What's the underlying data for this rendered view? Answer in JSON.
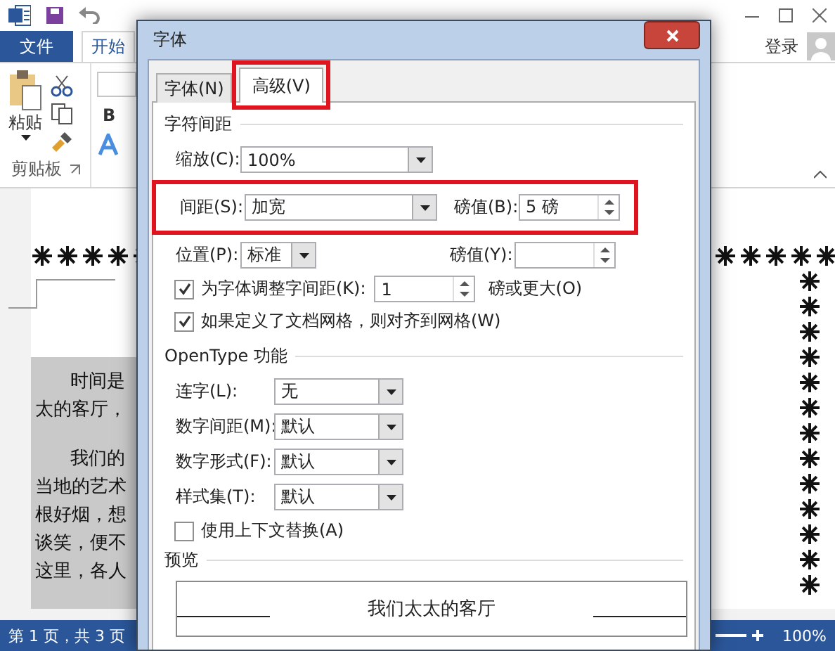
{
  "word": {
    "tabs": [
      {
        "label": "文件",
        "kind": "file",
        "selected": false
      },
      {
        "label": "开始",
        "kind": "tab",
        "selected": true
      }
    ],
    "account": "登录",
    "clipboard": {
      "paste": "粘贴",
      "group": "剪贴板"
    },
    "font_group": {
      "bold": "B"
    },
    "document": {
      "paragraphs": [
        [
          "时间是",
          "太的客厅，"
        ],
        [
          "我们的",
          "当地的艺术",
          "根好烟，想",
          "谈笑，便不",
          "这里，各人"
        ]
      ]
    },
    "status_bar": {
      "page": "第 1 页，共 3 页",
      "zoom": "100%"
    }
  },
  "dialog": {
    "title": "字体",
    "tabs": [
      {
        "label": "字体(N)",
        "selected": false
      },
      {
        "label": "高级(V)",
        "selected": true
      }
    ],
    "spacing_section": {
      "title": "字符间距",
      "scale": {
        "label": "缩放(C):",
        "value": "100%"
      },
      "spacing": {
        "label": "间距(S):",
        "value": "加宽",
        "by_label": "磅值(B):",
        "by_value": "5 磅"
      },
      "position": {
        "label": "位置(P):",
        "value": "标准",
        "by_label": "磅值(Y):"
      },
      "kerning": {
        "label": "为字体调整字间距(K):",
        "checked": true,
        "value": "1",
        "suffix": "磅或更大(O)"
      },
      "snap_to_grid": {
        "label": "如果定义了文档网格，则对齐到网格(W)",
        "checked": true
      }
    },
    "opentype": {
      "title": "OpenType 功能",
      "rows": [
        {
          "label": "连字(L):",
          "value": "无"
        },
        {
          "label": "数字间距(M):",
          "value": "默认"
        },
        {
          "label": "数字形式(F):",
          "value": "默认"
        },
        {
          "label": "样式集(T):",
          "value": "默认"
        }
      ],
      "contextual": {
        "label": "使用上下文替换(A)",
        "checked": false
      }
    },
    "preview": {
      "title": "预览",
      "text": "我们太太的客厅"
    }
  }
}
